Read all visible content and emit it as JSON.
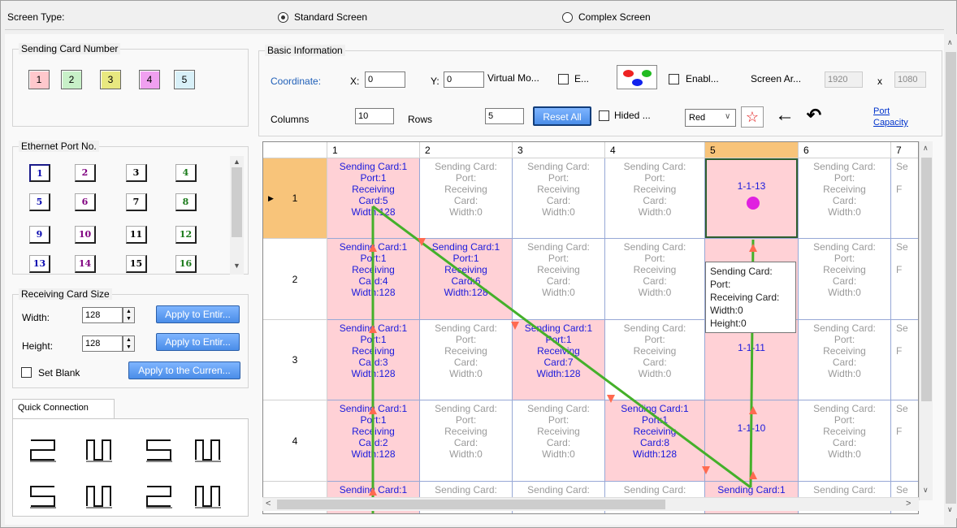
{
  "screen_type": {
    "label": "Screen Type:",
    "standard": "Standard Screen",
    "complex": "Complex Screen"
  },
  "sending_card": {
    "title": "Sending Card Number",
    "buttons": [
      "1",
      "2",
      "3",
      "4",
      "5"
    ],
    "colors": [
      "#ffc8cc",
      "#c8f0c8",
      "#e8e880",
      "#f0a0f0",
      "#d8f0f8"
    ]
  },
  "ethernet": {
    "title": "Ethernet Port No.",
    "ports": [
      "1",
      "2",
      "3",
      "4",
      "5",
      "6",
      "7",
      "8",
      "9",
      "10",
      "11",
      "12",
      "13",
      "14",
      "15",
      "16"
    ]
  },
  "receiving_size": {
    "title": "Receiving Card Size",
    "width_label": "Width:",
    "width_value": "128",
    "height_label": "Height:",
    "height_value": "128",
    "apply_entire_1": "Apply to Entir...",
    "apply_entire_2": "Apply to Entir...",
    "set_blank": "Set Blank",
    "apply_current": "Apply to the Curren..."
  },
  "quick_connection": {
    "tab": "Quick Connection"
  },
  "basic_info": {
    "title": "Basic Information",
    "coordinate": "Coordinate:",
    "x_label": "X:",
    "x_value": "0",
    "y_label": "Y:",
    "y_value": "0",
    "virtual_mode": "Virtual Mo...",
    "e_label": "E...",
    "enable_label": "Enabl...",
    "screen_area": "Screen Ar...",
    "screen_w": "1920",
    "x_sep": "x",
    "screen_h": "1080",
    "columns_label": "Columns",
    "columns_value": "10",
    "rows_label": "Rows",
    "rows_value": "5",
    "reset_all": "Reset All",
    "hided": "Hided ...",
    "color_select": "Red",
    "port_capacity_1": "Port",
    "port_capacity_2": "Capacity"
  },
  "grid": {
    "col_headers": [
      "1",
      "2",
      "3",
      "4",
      "5",
      "6",
      "7"
    ],
    "row_headers": [
      "1",
      "2",
      "3",
      "4"
    ],
    "selected_row_marker": "▶",
    "rows": [
      [
        {
          "on": true,
          "lines": [
            "Sending Card:1",
            "Port:1",
            "Receiving",
            "Card:5",
            "Width:128"
          ]
        },
        {
          "on": false,
          "lines": [
            "Sending Card:",
            "Port:",
            "Receiving",
            "Card:",
            "Width:0"
          ]
        },
        {
          "on": false,
          "lines": [
            "Sending Card:",
            "Port:",
            "Receiving",
            "Card:",
            "Width:0"
          ]
        },
        {
          "on": false,
          "lines": [
            "Sending Card:",
            "Port:",
            "Receiving",
            "Card:",
            "Width:0"
          ]
        },
        {
          "on": true,
          "mid": "1-1-13",
          "sel": true
        },
        {
          "on": false,
          "lines": [
            "Sending Card:",
            "Port:",
            "Receiving",
            "Card:",
            "Width:0"
          ]
        },
        {
          "on": false,
          "lines": [
            "Se",
            "",
            "F",
            "",
            ""
          ]
        }
      ],
      [
        {
          "on": true,
          "lines": [
            "Sending Card:1",
            "Port:1",
            "Receiving",
            "Card:4",
            "Width:128"
          ]
        },
        {
          "on": true,
          "lines": [
            "Sending Card:1",
            "Port:1",
            "Receiving",
            "Card:6",
            "Width:128"
          ]
        },
        {
          "on": false,
          "lines": [
            "Sending Card:",
            "Port:",
            "Receiving",
            "Card:",
            "Width:0"
          ]
        },
        {
          "on": false,
          "lines": [
            "Sending Card:",
            "Port:",
            "Receiving",
            "Card:",
            "Width:0"
          ]
        },
        {
          "on": true,
          "mid": ""
        },
        {
          "on": false,
          "lines": [
            "Sending Card:",
            "Port:",
            "Receiving",
            "Card:",
            "Width:0"
          ]
        },
        {
          "on": false,
          "lines": [
            "Se",
            "",
            "F",
            "",
            ""
          ]
        }
      ],
      [
        {
          "on": true,
          "lines": [
            "Sending Card:1",
            "Port:1",
            "Receiving",
            "Card:3",
            "Width:128"
          ]
        },
        {
          "on": false,
          "lines": [
            "Sending Card:",
            "Port:",
            "Receiving",
            "Card:",
            "Width:0"
          ]
        },
        {
          "on": true,
          "lines": [
            "Sending Card:1",
            "Port:1",
            "Receiving",
            "Card:7",
            "Width:128"
          ]
        },
        {
          "on": false,
          "lines": [
            "Sending Card:",
            "Port:",
            "Receiving",
            "Card:",
            "Width:0"
          ]
        },
        {
          "on": true,
          "mid": "1-1-11"
        },
        {
          "on": false,
          "lines": [
            "Sending Card:",
            "Port:",
            "Receiving",
            "Card:",
            "Width:0"
          ]
        },
        {
          "on": false,
          "lines": [
            "Se",
            "",
            "F",
            "",
            ""
          ]
        }
      ],
      [
        {
          "on": true,
          "lines": [
            "Sending Card:1",
            "Port:1",
            "Receiving",
            "Card:2",
            "Width:128"
          ]
        },
        {
          "on": false,
          "lines": [
            "Sending Card:",
            "Port:",
            "Receiving",
            "Card:",
            "Width:0"
          ]
        },
        {
          "on": false,
          "lines": [
            "Sending Card:",
            "Port:",
            "Receiving",
            "Card:",
            "Width:0"
          ]
        },
        {
          "on": true,
          "lines": [
            "Sending Card:1",
            "Port:1",
            "Receiving",
            "Card:8",
            "Width:128"
          ]
        },
        {
          "on": true,
          "mid": "1-1-10"
        },
        {
          "on": false,
          "lines": [
            "Sending Card:",
            "Port:",
            "Receiving",
            "Card:",
            "Width:0"
          ]
        },
        {
          "on": false,
          "lines": [
            "Se",
            "",
            "F",
            "",
            ""
          ]
        }
      ],
      [
        {
          "on": true,
          "lines": [
            "Sending Card:1"
          ]
        },
        {
          "on": false,
          "lines": [
            "Sending Card:"
          ]
        },
        {
          "on": false,
          "lines": [
            "Sending Card:"
          ]
        },
        {
          "on": false,
          "lines": [
            "Sending Card:"
          ]
        },
        {
          "on": true,
          "lines": [
            "Sending Card:1"
          ]
        },
        {
          "on": false,
          "lines": [
            "Sending Card:"
          ]
        },
        {
          "on": false,
          "lines": [
            "Se"
          ]
        }
      ]
    ]
  },
  "tooltip": {
    "lines": [
      "Sending Card:",
      "Port:",
      "Receiving Card:",
      "Width:0",
      "Height:0"
    ]
  },
  "colors": {
    "accent": "#1a1adc",
    "on_cell": "#ffd1d6",
    "path": "#44b02a",
    "arrow": "#ff6a50",
    "header_selected": "#f8c47a"
  }
}
